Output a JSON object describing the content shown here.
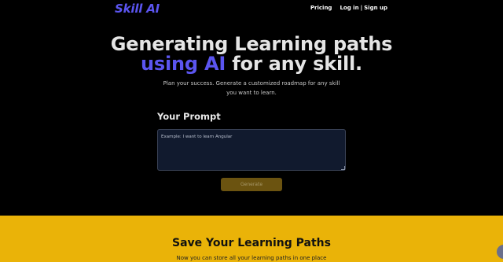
{
  "header": {
    "brand": "Skill AI",
    "nav": {
      "pricing": "Pricing",
      "login": "Log in",
      "separator": "|",
      "signup": "Sign up"
    }
  },
  "hero": {
    "title_line1": "Generating Learning paths",
    "title_line2_accent": "using AI",
    "title_line2_rest": " for any skill.",
    "subtitle": "Plan your success. Generate a customized roadmap for any skill you want to learn."
  },
  "prompt": {
    "label": "Your Prompt",
    "placeholder": "Example: I want to learn Angular",
    "value": ""
  },
  "generate_button": {
    "label": "Generate"
  },
  "save_section": {
    "title": "Save Your Learning Paths",
    "subtitle": "Now you can store all your learning paths in one place"
  },
  "colors": {
    "accent": "#5b55f0",
    "background": "#000000",
    "section_yellow": "#eab308",
    "button_disabled": "#6b5310",
    "textarea_bg": "#111a2e"
  }
}
